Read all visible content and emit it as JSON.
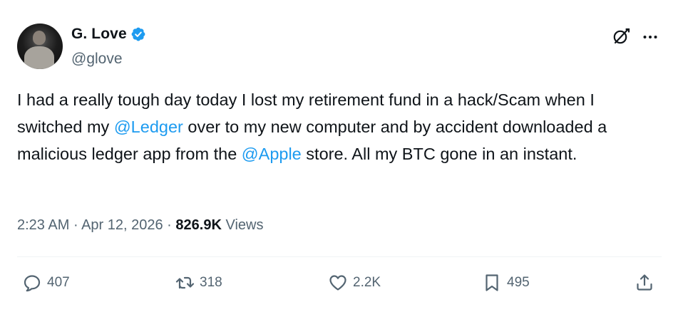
{
  "author": {
    "display_name": "G. Love",
    "handle": "@glove",
    "verified": true
  },
  "tweet": {
    "text_segments": [
      {
        "text": "I had a really tough day today I lost my retirement fund in a hack/Scam when I switched my ",
        "mention": false
      },
      {
        "text": "@Ledger",
        "mention": true
      },
      {
        "text": " over to my new computer and by accident downloaded a malicious ledger app from the ",
        "mention": false
      },
      {
        "text": "@Apple",
        "mention": true
      },
      {
        "text": " store. All my BTC gone in an instant.",
        "mention": false
      }
    ],
    "time": "2:23 AM",
    "separator": "·",
    "date": "Apr 12, 2026",
    "views_count": "826.9K",
    "views_label": "Views"
  },
  "actions": {
    "replies": "407",
    "reposts": "318",
    "likes": "2.2K",
    "bookmarks": "495"
  },
  "icons": {
    "verified": "verified-badge-icon",
    "grok": "grok-icon",
    "more": "more-icon",
    "reply": "reply-icon",
    "repost": "repost-icon",
    "like": "heart-icon",
    "bookmark": "bookmark-icon",
    "share": "share-icon"
  },
  "colors": {
    "text": "#0f1419",
    "secondary": "#536471",
    "accent": "#1d9bf0",
    "divider": "#eff3f4"
  }
}
